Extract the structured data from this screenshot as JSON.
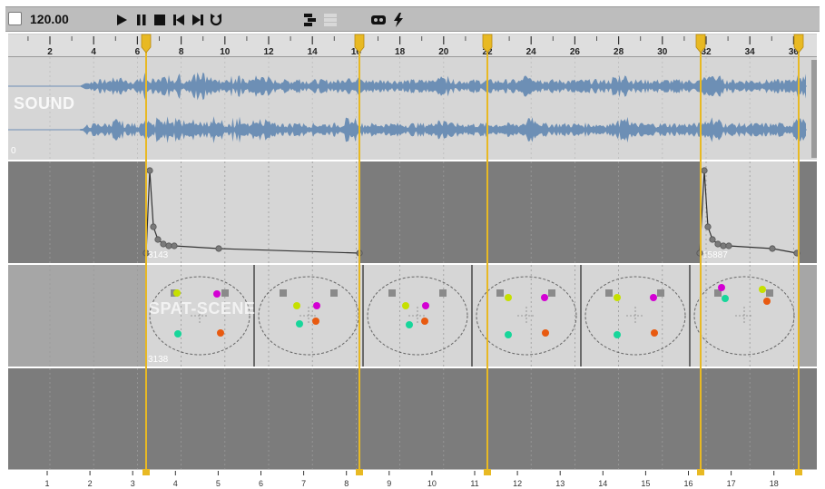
{
  "toolbar": {
    "tempo": "120.00",
    "buttons": [
      {
        "name": "play-icon"
      },
      {
        "name": "pause-icon"
      },
      {
        "name": "stop-icon"
      },
      {
        "name": "skip-back-icon"
      },
      {
        "name": "skip-forward-icon"
      },
      {
        "name": "loop-icon"
      },
      {
        "name": "flowchart-icon"
      },
      {
        "name": "list-icon"
      },
      {
        "name": "controller-icon"
      },
      {
        "name": "lightning-icon"
      }
    ]
  },
  "ruler": {
    "labels": [
      "2",
      "4",
      "6",
      "8",
      "10",
      "12",
      "14",
      "16",
      "18",
      "20",
      "22",
      "24",
      "26",
      "28",
      "30",
      "32",
      "34",
      "36"
    ]
  },
  "bottom_ruler": {
    "labels": [
      "1",
      "2",
      "3",
      "4",
      "5",
      "6",
      "7",
      "8",
      "9",
      "10",
      "11",
      "12",
      "13",
      "14",
      "15",
      "16",
      "17",
      "18"
    ]
  },
  "tracks": {
    "sound": {
      "label": "SOUND",
      "value": "0"
    },
    "automation": {
      "value_left": "3143",
      "value_right": "15887"
    },
    "spat": {
      "label": "SPAT-SCENE",
      "value": "3138"
    }
  },
  "colors": {
    "marker": "#e8b923",
    "waveform": "#6d8fb5",
    "source_yellow": "#c6e000",
    "source_magenta": "#d300d3",
    "source_teal": "#17d69a",
    "source_orange": "#e85a10",
    "speaker": "#8a8a8a"
  }
}
